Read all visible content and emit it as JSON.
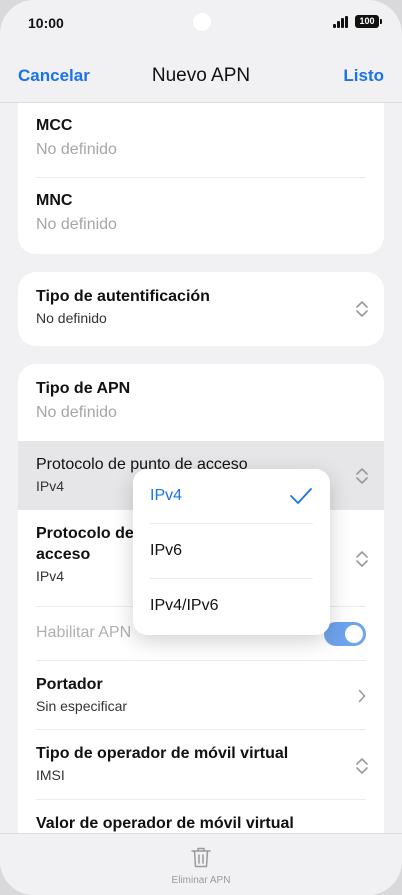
{
  "status": {
    "time": "10:00",
    "battery": "100"
  },
  "nav": {
    "cancel": "Cancelar",
    "title": "Nuevo APN",
    "done": "Listo"
  },
  "fields": {
    "mcc": {
      "label": "MCC",
      "placeholder": "No definido"
    },
    "mnc": {
      "label": "MNC",
      "placeholder": "No definido"
    },
    "auth": {
      "label": "Tipo de autentificación",
      "value": "No definido"
    },
    "apn_type": {
      "label": "Tipo de APN",
      "placeholder": "No definido"
    },
    "ap_protocol": {
      "label": "Protocolo de punto de acceso",
      "value": "IPv4"
    },
    "ap_roaming_protocol": {
      "label_line1": "Protocolo de",
      "label_line2": "acceso",
      "value": "IPv4"
    },
    "enable_apn": {
      "label": "Habilitar APN",
      "enabled": true
    },
    "bearer": {
      "label": "Portador",
      "value": "Sin especificar"
    },
    "mvno_type": {
      "label": "Tipo de operador de móvil virtual",
      "value": "IMSI"
    },
    "mvno_value": {
      "label": "Valor de operador de móvil virtual"
    }
  },
  "dropdown": {
    "options": [
      "IPv4",
      "IPv6",
      "IPv4/IPv6"
    ],
    "selected": "IPv4"
  },
  "bottom": {
    "delete_label": "Eliminar APN"
  },
  "colors": {
    "accent": "#1a73e8",
    "toggle_on": "#6ea4ee"
  }
}
